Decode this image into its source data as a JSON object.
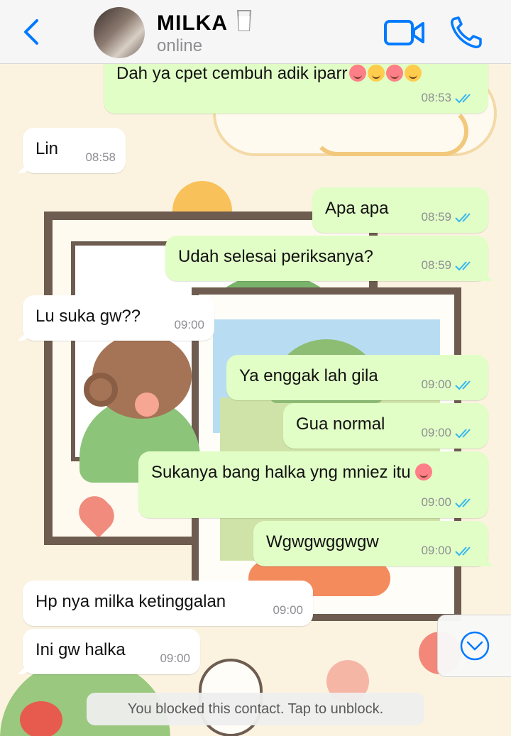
{
  "header": {
    "contact_name": "MILKA",
    "contact_status": "online",
    "back_icon": "chevron-left-icon",
    "video_icon": "video-camera-icon",
    "call_icon": "phone-icon",
    "accent_color": "#007aff"
  },
  "messages": [
    {
      "direction": "outgoing",
      "text": "Dah ya cpet cembuh adik iparr",
      "emojis": [
        "smiling-face-with-hearts",
        "hugging-face",
        "smiling-face",
        "yum-face"
      ],
      "time": "08:53",
      "read": true
    },
    {
      "direction": "incoming",
      "text": "Lin",
      "time": "08:58"
    },
    {
      "direction": "outgoing",
      "text": "Apa apa",
      "time": "08:59",
      "read": true
    },
    {
      "direction": "outgoing",
      "text": "Udah selesai periksanya?",
      "time": "08:59",
      "read": true
    },
    {
      "direction": "incoming",
      "text": "Lu suka gw??",
      "time": "09:00"
    },
    {
      "direction": "outgoing",
      "text": "Ya enggak lah gila",
      "time": "09:00",
      "read": true
    },
    {
      "direction": "outgoing",
      "text": "Gua normal",
      "time": "09:00",
      "read": true
    },
    {
      "direction": "outgoing",
      "text": "Sukanya bang halka yng mniez itu",
      "emojis": [
        "smiling-face-with-hearts"
      ],
      "time": "09:00",
      "read": true
    },
    {
      "direction": "outgoing",
      "text": "Wgwgwggwgw",
      "time": "09:00",
      "read": true
    },
    {
      "direction": "incoming",
      "text": "Hp nya milka ketinggalan",
      "time": "09:00"
    },
    {
      "direction": "incoming",
      "text": "Ini gw halka",
      "time": "09:00"
    }
  ],
  "system_notice": "You blocked this contact. Tap to unblock.",
  "colors": {
    "incoming_bubble": "#ffffff",
    "outgoing_bubble": "#e1fec6",
    "read_ticks": "#34b7f1",
    "header_bg": "#f6f6f6"
  }
}
